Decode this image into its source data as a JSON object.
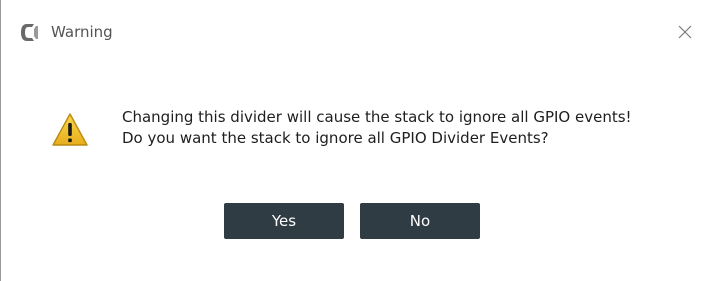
{
  "window": {
    "title": "Warning",
    "app_icon": "c-logo-icon",
    "close_icon": "close-icon"
  },
  "message": {
    "icon": "warning-icon",
    "line1": "Changing this divider will cause the stack to ignore all GPIO events!",
    "line2": "Do you want the stack to ignore all GPIO Divider Events?"
  },
  "buttons": {
    "yes_label": "Yes",
    "no_label": "No"
  },
  "colors": {
    "button_bg": "#2f3c43",
    "button_text": "#ffffff",
    "title_text": "#555555",
    "warning_yellow": "#f2c230"
  }
}
